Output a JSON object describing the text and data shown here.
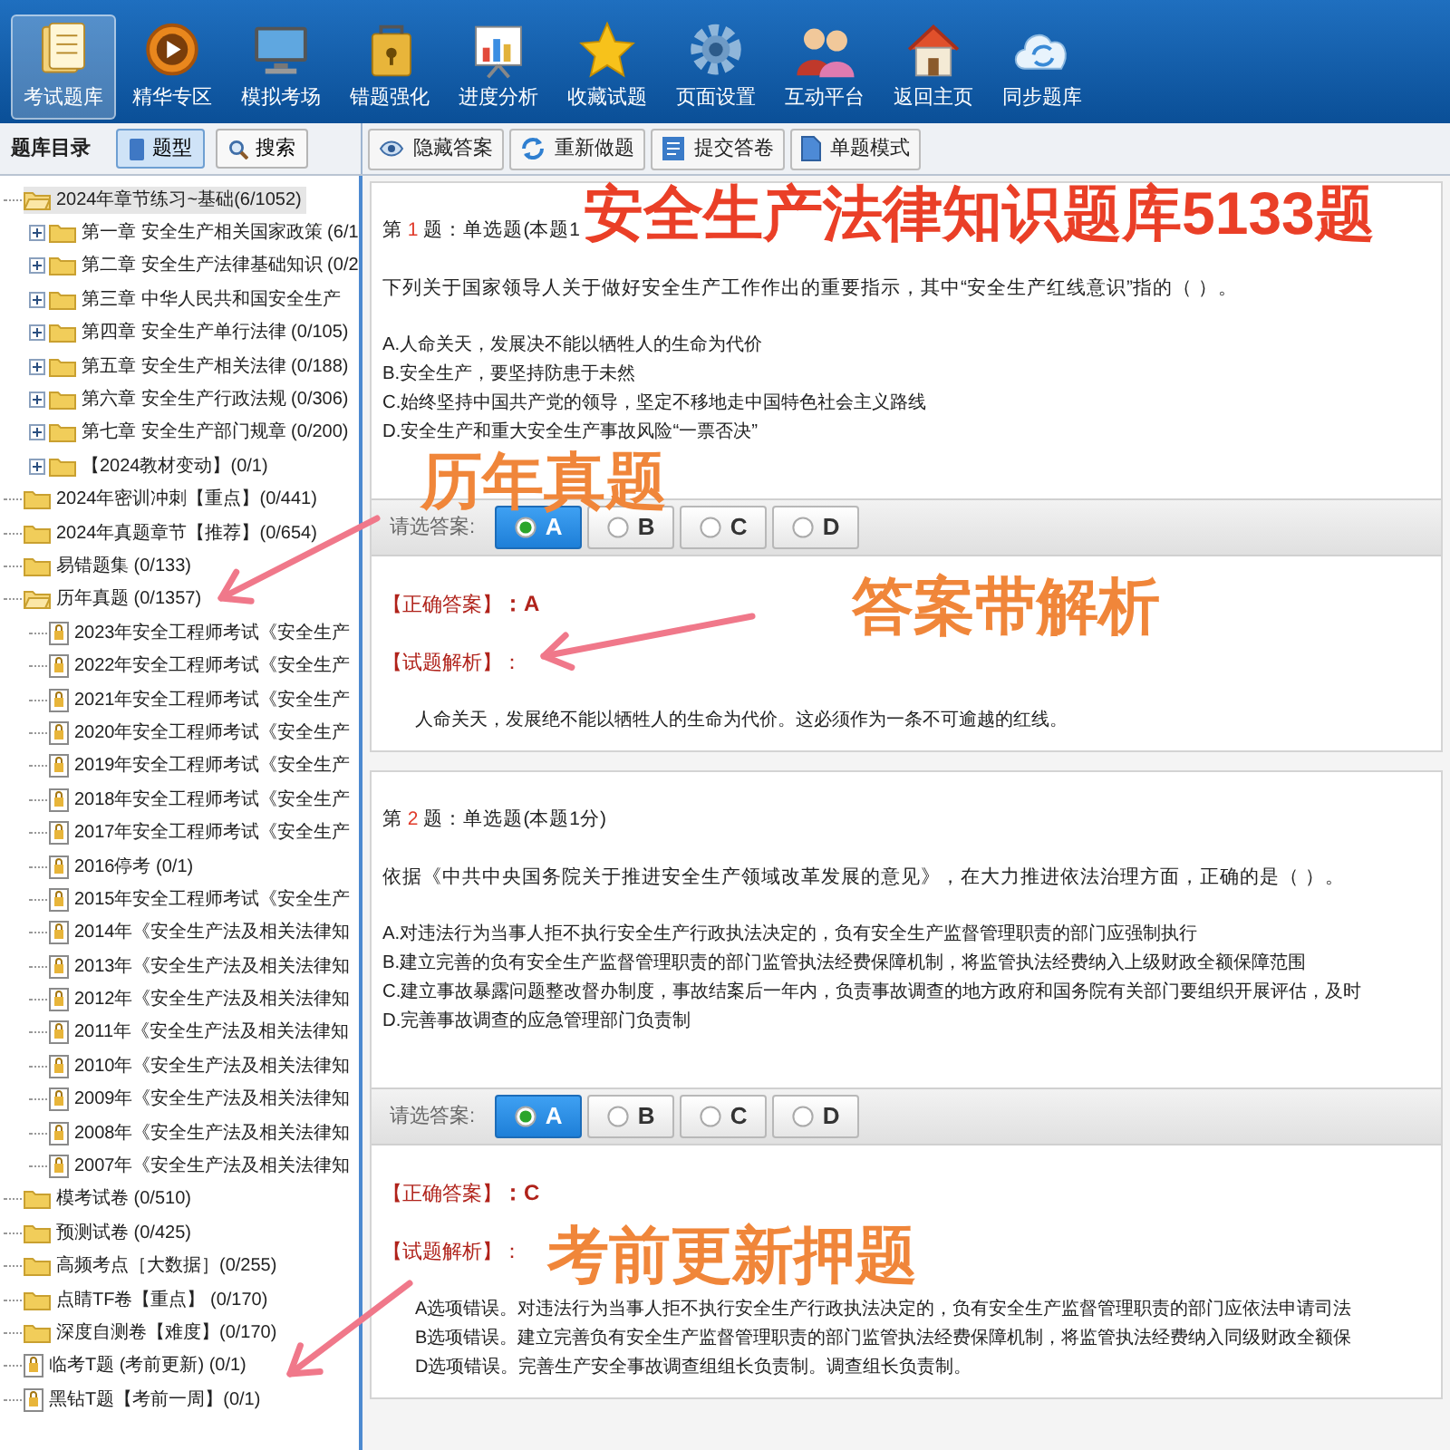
{
  "toolbar": [
    {
      "label": "考试题库",
      "selected": true
    },
    {
      "label": "精华专区",
      "selected": false
    },
    {
      "label": "模拟考场",
      "selected": false
    },
    {
      "label": "错题强化",
      "selected": false
    },
    {
      "label": "进度分析",
      "selected": false
    },
    {
      "label": "收藏试题",
      "selected": false
    },
    {
      "label": "页面设置",
      "selected": false
    },
    {
      "label": "互动平台",
      "selected": false
    },
    {
      "label": "返回主页",
      "selected": false
    },
    {
      "label": "同步题库",
      "selected": false
    }
  ],
  "left_panel": {
    "title": "题库目录",
    "buttons": [
      {
        "label": "题型",
        "selected": true
      },
      {
        "label": "搜索",
        "selected": false
      }
    ],
    "tree": [
      {
        "label": "2024年章节练习~基础(6/1052)",
        "kind": "folder",
        "selected": true,
        "expanded": true,
        "children": [
          {
            "label": "第一章  安全生产相关国家政策 (6/1",
            "kind": "folder",
            "selected": false,
            "expanded": false
          },
          {
            "label": "第二章  安全生产法律基础知识 (0/2",
            "kind": "folder",
            "selected": false,
            "expanded": false
          },
          {
            "label": "第三章  中华人民共和国安全生产",
            "kind": "folder",
            "selected": false,
            "expanded": false
          },
          {
            "label": "第四章  安全生产单行法律 (0/105)",
            "kind": "folder",
            "selected": false,
            "expanded": false
          },
          {
            "label": "第五章  安全生产相关法律 (0/188)",
            "kind": "folder",
            "selected": false,
            "expanded": false
          },
          {
            "label": "第六章  安全生产行政法规 (0/306)",
            "kind": "folder",
            "selected": false,
            "expanded": false
          },
          {
            "label": "第七章  安全生产部门规章 (0/200)",
            "kind": "folder",
            "selected": false,
            "expanded": false
          },
          {
            "label": "【2024教材变动】(0/1)",
            "kind": "folder",
            "selected": false,
            "expanded": false
          }
        ]
      },
      {
        "label": "2024年密训冲刺【重点】(0/441)",
        "kind": "folder",
        "selected": false
      },
      {
        "label": "2024年真题章节【推荐】(0/654)",
        "kind": "folder",
        "selected": false
      },
      {
        "label": "易错题集 (0/133)",
        "kind": "folder",
        "selected": false
      },
      {
        "label": "历年真题 (0/1357)",
        "kind": "folder",
        "selected": false,
        "expanded": true,
        "children": [
          {
            "label": "2023年安全工程师考试《安全生产",
            "kind": "paper",
            "selected": false
          },
          {
            "label": "2022年安全工程师考试《安全生产",
            "kind": "paper",
            "selected": false
          },
          {
            "label": "2021年安全工程师考试《安全生产",
            "kind": "paper",
            "selected": false
          },
          {
            "label": "2020年安全工程师考试《安全生产",
            "kind": "paper",
            "selected": false
          },
          {
            "label": "2019年安全工程师考试《安全生产",
            "kind": "paper",
            "selected": false
          },
          {
            "label": "2018年安全工程师考试《安全生产",
            "kind": "paper",
            "selected": false
          },
          {
            "label": "2017年安全工程师考试《安全生产",
            "kind": "paper",
            "selected": false
          },
          {
            "label": "2016停考 (0/1)",
            "kind": "paper",
            "selected": false
          },
          {
            "label": "2015年安全工程师考试《安全生产",
            "kind": "paper",
            "selected": false
          },
          {
            "label": "2014年《安全生产法及相关法律知",
            "kind": "paper",
            "selected": false
          },
          {
            "label": "2013年《安全生产法及相关法律知",
            "kind": "paper",
            "selected": false
          },
          {
            "label": "2012年《安全生产法及相关法律知",
            "kind": "paper",
            "selected": false
          },
          {
            "label": "2011年《安全生产法及相关法律知",
            "kind": "paper",
            "selected": false
          },
          {
            "label": "2010年《安全生产法及相关法律知",
            "kind": "paper",
            "selected": false
          },
          {
            "label": "2009年《安全生产法及相关法律知",
            "kind": "paper",
            "selected": false
          },
          {
            "label": "2008年《安全生产法及相关法律知",
            "kind": "paper",
            "selected": false
          },
          {
            "label": "2007年《安全生产法及相关法律知",
            "kind": "paper",
            "selected": false
          }
        ]
      },
      {
        "label": "模考试卷 (0/510)",
        "kind": "folder",
        "selected": false
      },
      {
        "label": "预测试卷 (0/425)",
        "kind": "folder",
        "selected": false
      },
      {
        "label": "高频考点［大数据］(0/255)",
        "kind": "folder",
        "selected": false
      },
      {
        "label": "点睛TF卷【重点】 (0/170)",
        "kind": "folder",
        "selected": false
      },
      {
        "label": "深度自测卷【难度】(0/170)",
        "kind": "folder",
        "selected": false
      },
      {
        "label": "临考T题 (考前更新) (0/1)",
        "kind": "paper",
        "selected": false
      },
      {
        "label": "黑钻T题【考前一周】(0/1)",
        "kind": "paper",
        "selected": false
      }
    ]
  },
  "action_buttons": [
    "隐藏答案",
    "重新做题",
    "提交答卷",
    "单题模式"
  ],
  "questions": [
    {
      "prefix": "第",
      "number": "1",
      "suffix": "题：单选题(本题1",
      "text": "下列关于国家领导人关于做好安全生产工作作出的重要指示，其中“安全生产红线意识”指的（  ）。",
      "options": [
        "A.人命关天，发展决不能以牺牲人的生命为代价",
        "B.安全生产，要坚持防患于未然",
        "C.始终坚持中国共产党的领导，坚定不移地走中国特色社会主义路线",
        "D.安全生产和重大安全生产事故风险“一票否决”"
      ],
      "answer_prompt": "请选答案:",
      "choices": [
        {
          "label": "A",
          "selected": true
        },
        {
          "label": "B",
          "selected": false
        },
        {
          "label": "C",
          "selected": false
        },
        {
          "label": "D",
          "selected": false
        }
      ],
      "correct_label": "【正确答案】",
      "correct_value": "：A",
      "analysis_label": "【试题解析】：",
      "explanation": [
        "人命关天，发展绝不能以牺牲人的生命为代价。这必须作为一条不可逾越的红线。"
      ]
    },
    {
      "prefix": "第",
      "number": "2",
      "suffix": "题：单选题(本题1分)",
      "text": "依据《中共中央国务院关于推进安全生产领域改革发展的意见》，在大力推进依法治理方面，正确的是（  ）。",
      "options": [
        "A.对违法行为当事人拒不执行安全生产行政执法决定的，负有安全生产监督管理职责的部门应强制执行",
        "B.建立完善的负有安全生产监督管理职责的部门监管执法经费保障机制，将监管执法经费纳入上级财政全额保障范围",
        "C.建立事故暴露问题整改督办制度，事故结案后一年内，负责事故调查的地方政府和国务院有关部门要组织开展评估，及时",
        "D.完善事故调查的应急管理部门负责制"
      ],
      "answer_prompt": "请选答案:",
      "choices": [
        {
          "label": "A",
          "selected": true
        },
        {
          "label": "B",
          "selected": false
        },
        {
          "label": "C",
          "selected": false
        },
        {
          "label": "D",
          "selected": false
        }
      ],
      "correct_label": "【正确答案】",
      "correct_value": "：C",
      "analysis_label": "【试题解析】：",
      "explanation": [
        "A选项错误。对违法行为当事人拒不执行安全生产行政执法决定的，负有安全生产监督管理职责的部门应依法申请司法",
        "B选项错误。建立完善负有安全生产监督管理职责的部门监管执法经费保障机制，将监管执法经费纳入同级财政全额保",
        "D选项错误。完善生产安全事故调查组组长负责制。调查组长负责制。"
      ]
    }
  ],
  "annotations": [
    {
      "text": "安全生产法律知识题库5133题",
      "kind": "title"
    },
    {
      "text": "历年真题",
      "kind": "callout"
    },
    {
      "text": "答案带解析",
      "kind": "callout"
    },
    {
      "text": "考前更新押题",
      "kind": "callout"
    }
  ]
}
